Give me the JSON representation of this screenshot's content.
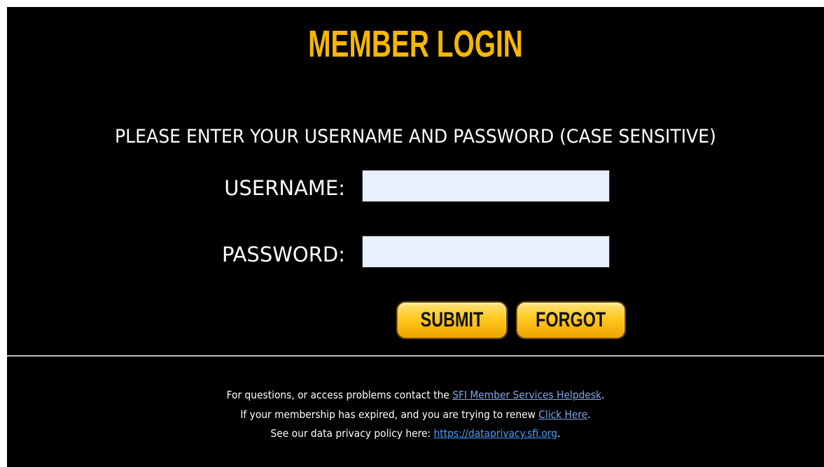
{
  "header": {
    "title": "MEMBER LOGIN"
  },
  "form": {
    "instructions": "PLEASE ENTER YOUR USERNAME AND PASSWORD (CASE SENSITIVE)",
    "username_label": "USERNAME:",
    "username_value": "",
    "password_label": "PASSWORD:",
    "password_value": "",
    "submit_label": "SUBMIT",
    "forgot_label": "FORGOT"
  },
  "footer": {
    "line1_text": "For questions, or access problems contact the ",
    "line1_link": "SFI Member Services Helpdesk",
    "line1_end": ".",
    "line2_text": "If your membership has expired, and you are trying to renew ",
    "line2_link": "Click Here",
    "line2_end": ".",
    "line3_text": "See our data privacy policy here: ",
    "line3_link": "https://dataprivacy.sfi.org",
    "line3_end": "."
  },
  "colors": {
    "background": "#000000",
    "title": "#f5b700",
    "button": "#ffc81f",
    "input": "#e8f0fe",
    "link": "#7fa7e8"
  }
}
